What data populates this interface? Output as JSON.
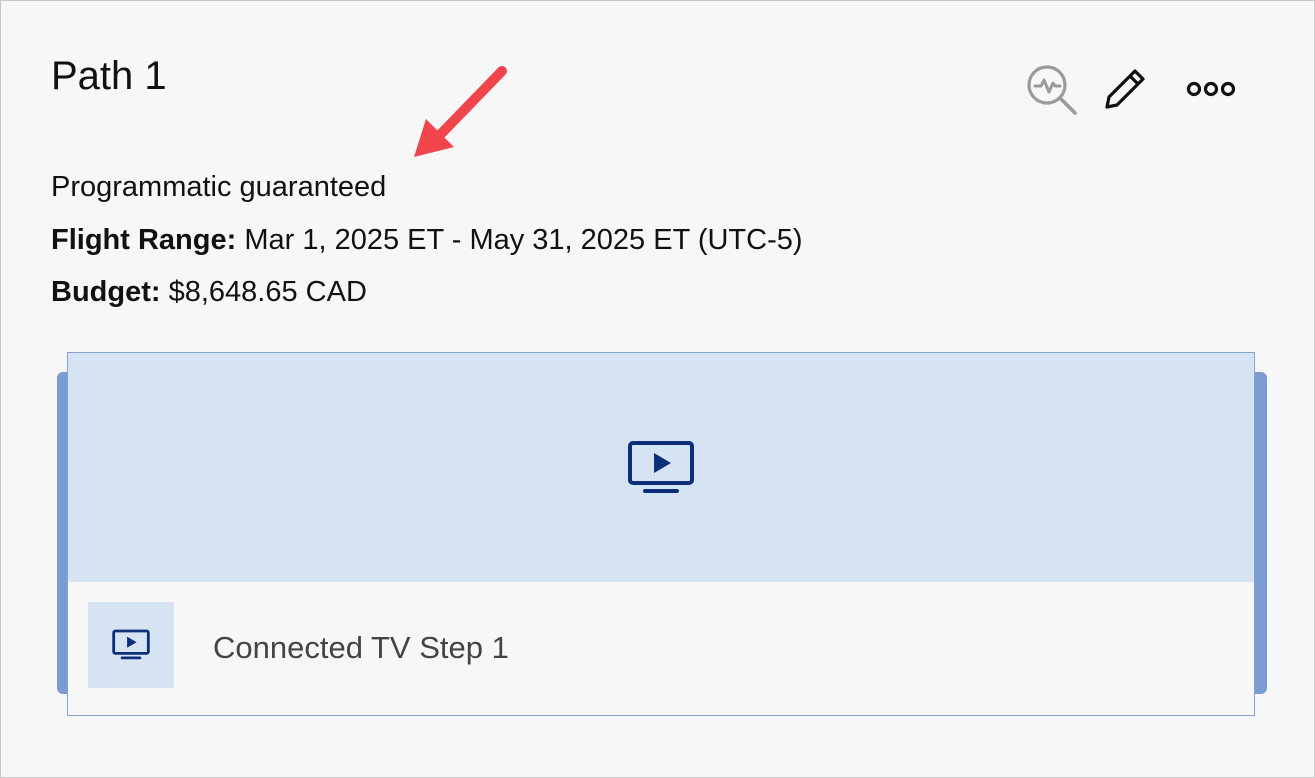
{
  "path": {
    "title": "Path 1"
  },
  "toolbar": {
    "insights_icon": "magnifier-pulse-icon",
    "edit_icon": "pencil-icon",
    "more_icon": "more-horizontal-icon"
  },
  "details": {
    "deal_type": "Programmatic guaranteed",
    "flight_range_label": "Flight Range:",
    "flight_range_value": "Mar 1, 2025 ET - May 31, 2025 ET (UTC-5)",
    "budget_label": "Budget:",
    "budget_value": "$8,648.65 CAD"
  },
  "step": {
    "media_icon": "connected-tv-icon",
    "label": "Connected TV Step 1"
  },
  "colors": {
    "accent_dark": "#0b2f7a",
    "media_bg": "#d5e3f3",
    "card_border": "#86a2d2",
    "annotation": "#f0464b"
  }
}
